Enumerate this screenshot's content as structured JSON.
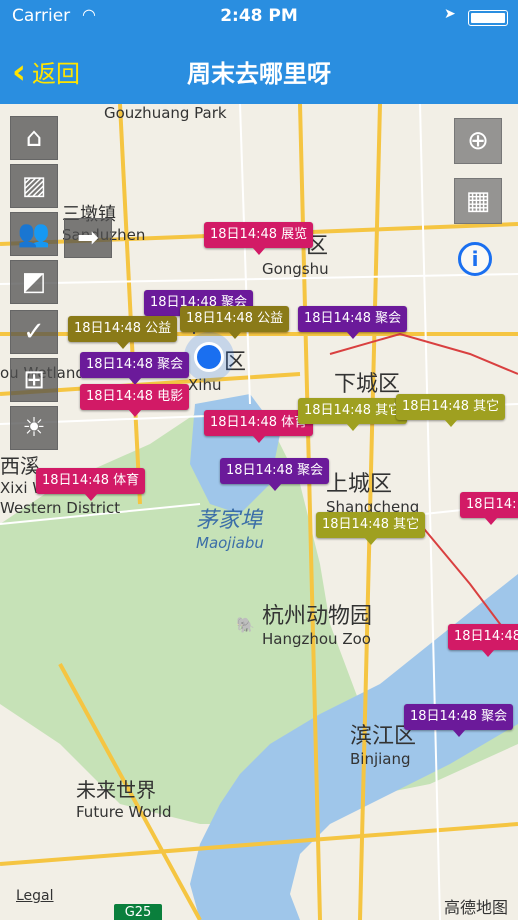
{
  "status_bar": {
    "carrier": "Carrier",
    "time": "2:48 PM"
  },
  "nav": {
    "back_label": "返回",
    "title": "周末去哪里呀"
  },
  "map": {
    "places": {
      "gouzhuang": "Gouzhuang Park",
      "sandun_cn": "三墩镇",
      "sandun_en": "Sanduzhen",
      "gongshu_cn": "区",
      "gongshu_en": "Gongshu",
      "xihu_cn": "区",
      "xihu_en": "Xihu",
      "xiacheng_cn": "下城区",
      "wetland_cn": "西溪",
      "wetland_en": "Xixi Wetland",
      "western_en": "Western District",
      "shangcheng_cn": "上城区",
      "shangcheng_en": "Shangcheng",
      "maojiabu_cn": "茅家埠",
      "maojiabu_en": "Maojiabu",
      "zoo_cn": "杭州动物园",
      "zoo_en": "Hangzhou Zoo",
      "binjiang_cn": "滨江区",
      "binjiang_en": "Binjiang",
      "future_cn": "未来世界",
      "future_en": "Future World",
      "garden_en": "ou Wetland Garden"
    },
    "highway": "G25",
    "legal": "Legal",
    "provider": "高德地图"
  },
  "event_tags": [
    "18日14:48 展览",
    "18日14:48 聚会",
    "18日14:48 公益",
    "18日14:48 公益",
    "18日14:48 聚会",
    "18日14:48 聚会",
    "18日14:48 电影",
    "18日14:48 体育",
    "18日14:48 其它",
    "18日14:48 其它",
    "18日14:48 体育",
    "18日14:48 聚会",
    "18日14:48 其它",
    "18日14:",
    "18日14:48",
    "18日14:48 聚会"
  ],
  "left_toolbar": [
    "home-icon",
    "picture-icon",
    "people-icon",
    "arrow-icon",
    "photos-icon",
    "check-icon",
    "windows-icon",
    "weather-icon"
  ],
  "right_toolbar": [
    "locate-icon",
    "traffic-icon",
    "info-icon"
  ]
}
